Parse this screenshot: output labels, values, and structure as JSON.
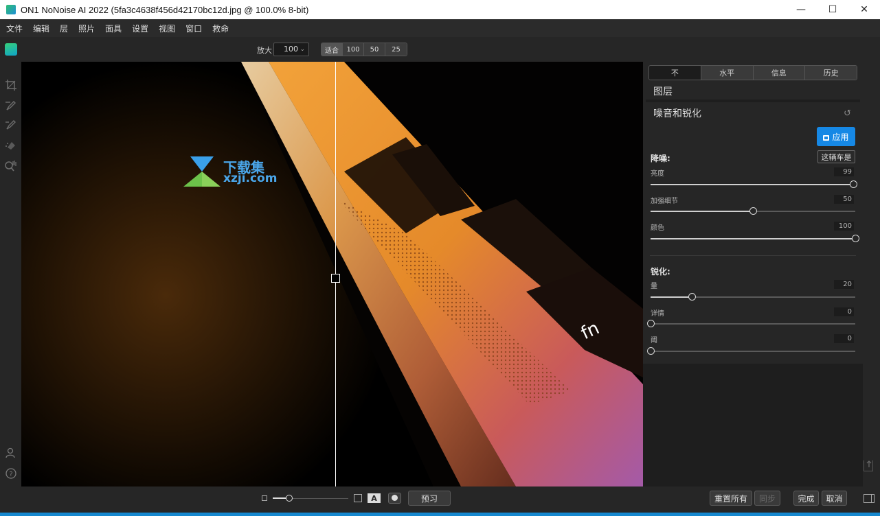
{
  "window": {
    "title": "ON1 NoNoise AI 2022 (5fa3c4638f456d42170bc12d.jpg @ 100.0% 8-bit)",
    "controls": {
      "minimize": "—",
      "maximize": "☐",
      "close": "✕"
    }
  },
  "menu": {
    "items": [
      "文件",
      "编辑",
      "层",
      "照片",
      "面具",
      "设置",
      "视图",
      "窗口",
      "救命"
    ]
  },
  "toolbar": {
    "zoom_label": "放大",
    "zoom_value": "100",
    "zoom_options": [
      "适合",
      "100",
      "50",
      "25"
    ],
    "active_zoom": "适合"
  },
  "canvas": {
    "watermark_line1": "下载集",
    "watermark_line2": "xzji.com",
    "key_label": "fn"
  },
  "bottom_bar": {
    "a_icon_label": "A",
    "preview_label": "预习",
    "reset_all_label": "重置所有",
    "sync_label": "同步",
    "done_label": "完成",
    "cancel_label": "取消"
  },
  "panel": {
    "tabs": [
      "不",
      "水平",
      "信息",
      "历史"
    ],
    "active_tab": "不",
    "layers_title": "图层",
    "section_title": "噪音和锐化",
    "apply_label": "应用",
    "noise_group": "降噪:",
    "preset_label": "这辆车是",
    "noise_sliders": [
      {
        "label": "亮度",
        "value": 99
      },
      {
        "label": "加强细节",
        "value": 50
      },
      {
        "label": "颜色",
        "value": 100
      }
    ],
    "sharpen_group": "锐化:",
    "sharpen_sliders": [
      {
        "label": "量",
        "value": 20
      },
      {
        "label": "详情",
        "value": 0
      },
      {
        "label": "阈",
        "value": 0
      }
    ]
  },
  "colors": {
    "accent": "#1688e5",
    "window_edge": "#1688cf",
    "background": "#262626"
  }
}
